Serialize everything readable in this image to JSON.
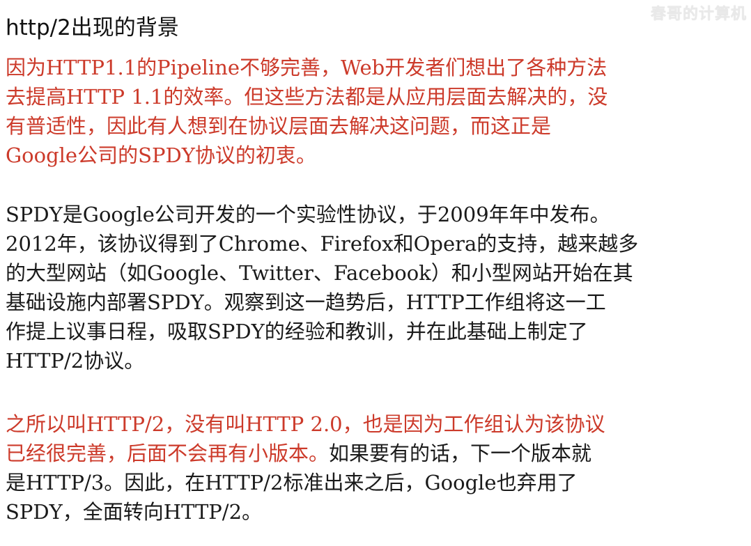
{
  "watermark": "春哥的计算机",
  "title": "http/2出现的背景",
  "paragraphs": {
    "p1": "  因为HTTP1.1的Pipeline不够完善，Web开发者们想出了各种方法\n去提高HTTP 1.1的效率。但这些方法都是从应用层面去解决的，没\n有普适性，因此有人想到在协议层面去解决这问题，而这正是\nGoogle公司的SPDY协议的初衷。",
    "p2": "  SPDY是Google公司开发的一个实验性协议，于2009年年中发布。\n2012年，该协议得到了Chrome、Firefox和Opera的支持，越来越多\n的大型网站（如Google、Twitter、Facebook）和小型网站开始在其\n基础设施内部署SPDY。观察到这一趋势后，HTTP工作组将这一工\n作提上议事日程，吸取SPDY的经验和教训，并在此基础上制定了\nHTTP/2协议。",
    "p3_red": "  之所以叫HTTP/2，没有叫HTTP 2.0，也是因为工作组认为该协议\n已经很完善，后面不会再有小版本。",
    "p3_black": "如果要有的话，下一个版本就\n是HTTP/3。因此，在HTTP/2标准出来之后，Google也弃用了\nSPDY，全面转向HTTP/2。"
  },
  "colors": {
    "red_text": "#cc3a2a",
    "black_text": "#1a1a1a",
    "background": "#ffffff"
  }
}
